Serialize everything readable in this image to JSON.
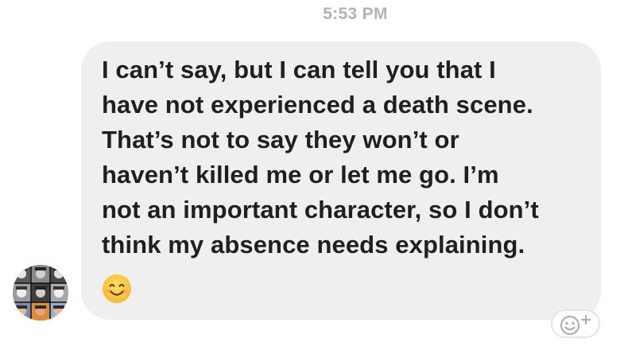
{
  "conversation": {
    "timestamp": "5:53 PM",
    "message": {
      "text": "I can’t say, but I can tell you that I\nhave not experienced a death scene.\nThat’s not to say they won’t or\nhaven’t killed me or let me go. I’m\nnot an important character, so I don’t\nthink my absence needs explaining.",
      "emoji": "smiling-face-icon"
    },
    "sender_avatar": "avatar-photo-grid",
    "reaction_button": "add-reaction-icon"
  },
  "colors": {
    "bubble": "#efeff0",
    "text": "#1f1f1f",
    "timestamp": "#b3b3b7",
    "emoji_face": "#ffc83d"
  }
}
